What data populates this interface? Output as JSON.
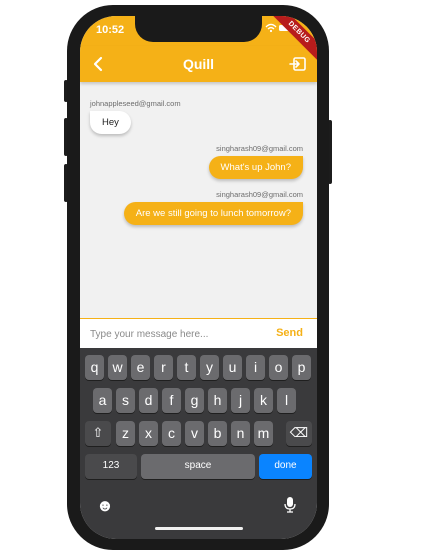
{
  "status_bar": {
    "time": "10:52",
    "icons": "wifi battery",
    "debug_banner": "DEBUG"
  },
  "app_bar": {
    "title": "Quill",
    "back_icon": "chevron-left-icon",
    "exit_icon": "exit-icon"
  },
  "messages": [
    {
      "sender": "johnappleseed@gmail.com",
      "text": "Hey",
      "side": "in"
    },
    {
      "sender": "singharash09@gmail.com",
      "text": "What's up John?",
      "side": "out"
    },
    {
      "sender": "singharash09@gmail.com",
      "text": "Are we still going to lunch tomorrow?",
      "side": "out"
    }
  ],
  "input": {
    "placeholder": "Type your message here...",
    "value": "",
    "send_label": "Send"
  },
  "keyboard": {
    "row1": [
      "q",
      "w",
      "e",
      "r",
      "t",
      "y",
      "u",
      "i",
      "o",
      "p"
    ],
    "row2": [
      "a",
      "s",
      "d",
      "f",
      "g",
      "h",
      "j",
      "k",
      "l"
    ],
    "row3": [
      "z",
      "x",
      "c",
      "v",
      "b",
      "n",
      "m"
    ],
    "shift": "⇧",
    "backspace": "⌫",
    "numbers_label": "123",
    "space_label": "space",
    "done_label": "done",
    "emoji_icon": "☻",
    "mic_icon": "🎙"
  },
  "colors": {
    "accent": "#f5b117",
    "done": "#0a84ff",
    "debug": "#b71c1c"
  }
}
